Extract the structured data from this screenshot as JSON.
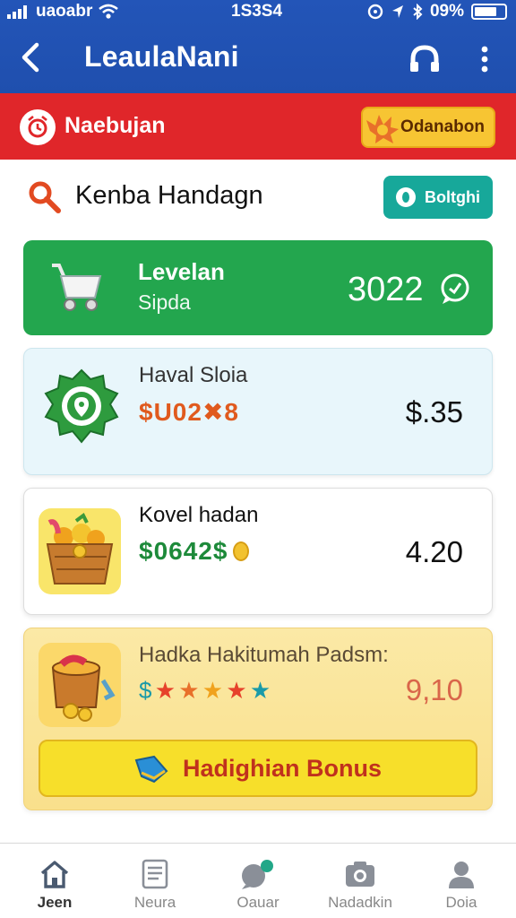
{
  "status_bar": {
    "carrier": "uaoabr",
    "time": "1S3S4",
    "battery": "09%"
  },
  "app_bar": {
    "title": "LeaulaNani"
  },
  "banner": {
    "title": "Naebujan",
    "button_label": "Odanabon"
  },
  "section": {
    "title": "Kenba Handagn",
    "button_label": "Boltghi"
  },
  "cards": [
    {
      "title": "Levelan",
      "subtitle": "Sipda",
      "amount": "3022"
    },
    {
      "title": "Haval Sloia",
      "code": "$U02✖8",
      "price": "$.35"
    },
    {
      "title": "Kovel hadan",
      "code": "$0642$",
      "price": "4.20"
    },
    {
      "title": "Hadka Hakitumah Padsm:",
      "stars": [
        "$",
        "★",
        "★",
        "★",
        "★",
        "★"
      ],
      "price": "9,10",
      "button_label": "Hadighian Bonus"
    }
  ],
  "bottom_nav": {
    "items": [
      {
        "label": "Jeen",
        "active": true
      },
      {
        "label": "Neura",
        "active": false
      },
      {
        "label": "Oauar",
        "active": false
      },
      {
        "label": "Nadadkin",
        "active": false
      },
      {
        "label": "Doia",
        "active": false
      }
    ]
  },
  "colors": {
    "app_bar": "#2355b8",
    "banner": "#e0262a",
    "card_green": "#23a64e",
    "teal": "#17a89a",
    "bonus_button": "#f7df2a"
  },
  "icons": {
    "back": "back-arrow-icon",
    "head": "headphones-icon",
    "more": "more-vertical-icon",
    "search": "search-icon"
  }
}
